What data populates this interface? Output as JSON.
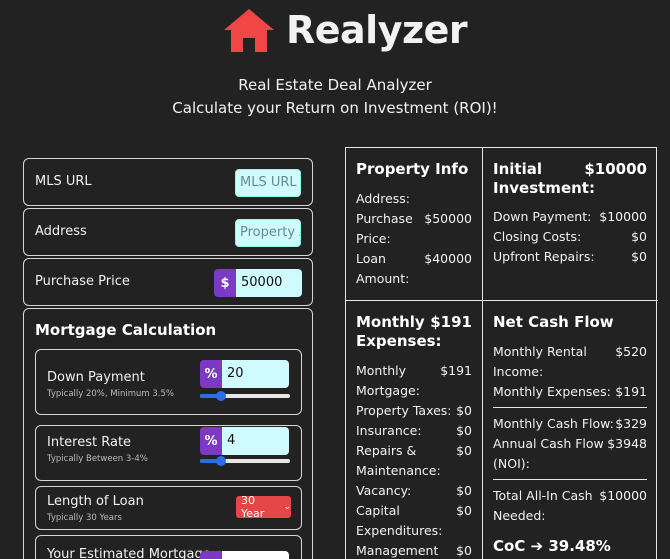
{
  "header": {
    "title": "Realyzer",
    "subtitle1": "Real Estate Deal Analyzer",
    "subtitle2": "Calculate your Return on Investment (ROI)!",
    "logo_color": "#f04646",
    "logo_icon": "house-icon"
  },
  "form": {
    "mls": {
      "label": "MLS URL",
      "placeholder": "MLS URL"
    },
    "address": {
      "label": "Address",
      "placeholder": "Property A"
    },
    "price": {
      "label": "Purchase Price",
      "prefix": "$",
      "value": "50000"
    }
  },
  "mortgage": {
    "title": "Mortgage Calculation",
    "down_payment": {
      "label": "Down Payment",
      "hint": "Typically 20%, Minimum 3.5%",
      "prefix": "%",
      "value": "20",
      "slider_fraction": 0.2
    },
    "interest_rate": {
      "label": "Interest Rate",
      "hint": "Typically Between 3-4%",
      "prefix": "%",
      "value": "4",
      "slider_fraction": 0.2
    },
    "loan_length": {
      "label": "Length of Loan",
      "hint": "Typically 30 Years",
      "selected": "30 Year"
    },
    "estimated": {
      "label": "Your Estimated Mortgage"
    }
  },
  "property_info": {
    "title": "Property Info",
    "address_label": "Address:",
    "purchase_price_label_1": "Purchase",
    "purchase_price_label_2": "Price:",
    "purchase_price_value": "$50000",
    "loan_label_1": "Loan",
    "loan_label_2": "Amount:",
    "loan_value": "$40000"
  },
  "initial_investment": {
    "title_1": "Initial",
    "title_2": "Investment:",
    "total": "$10000",
    "down_payment_label": "Down Payment:",
    "down_payment_value": "$10000",
    "closing_costs_label": "Closing Costs:",
    "closing_costs_value": "$0",
    "upfront_repairs_label": "Upfront Repairs:",
    "upfront_repairs_value": "$0"
  },
  "monthly_expenses": {
    "title_1": "Monthly",
    "title_2": "Expenses:",
    "total": "$191",
    "mortgage_label_1": "Monthly",
    "mortgage_label_2": "Mortgage:",
    "mortgage_value": "$191",
    "taxes_label": "Property Taxes:",
    "taxes_value": "$0",
    "insurance_label": "Insurance:",
    "insurance_value": "$0",
    "repairs_label_1": "Repairs &",
    "repairs_label_2": "Maintenance:",
    "repairs_value": "$0",
    "vacancy_label": "Vacancy:",
    "vacancy_value": "$0",
    "capex_label_1": "Capital",
    "capex_label_2": "Expenditures:",
    "capex_value": "$0",
    "management_label": "Management",
    "management_value": "$0"
  },
  "net_cash_flow": {
    "title": "Net Cash Flow",
    "rental_label_1": "Monthly Rental",
    "rental_label_2": "Income:",
    "rental_value": "$520",
    "expenses_label": "Monthly Expenses:",
    "expenses_value": "$191",
    "cash_flow_label": "Monthly Cash Flow:",
    "cash_flow_value": "$329",
    "annual_label_1": "Annual Cash Flow",
    "annual_label_2": "(NOI):",
    "annual_value": "$3948",
    "allin_label_1": "Total All-In Cash",
    "allin_label_2": "Needed:",
    "allin_value": "$10000",
    "coc": "CoC ➔ 39.48%"
  }
}
